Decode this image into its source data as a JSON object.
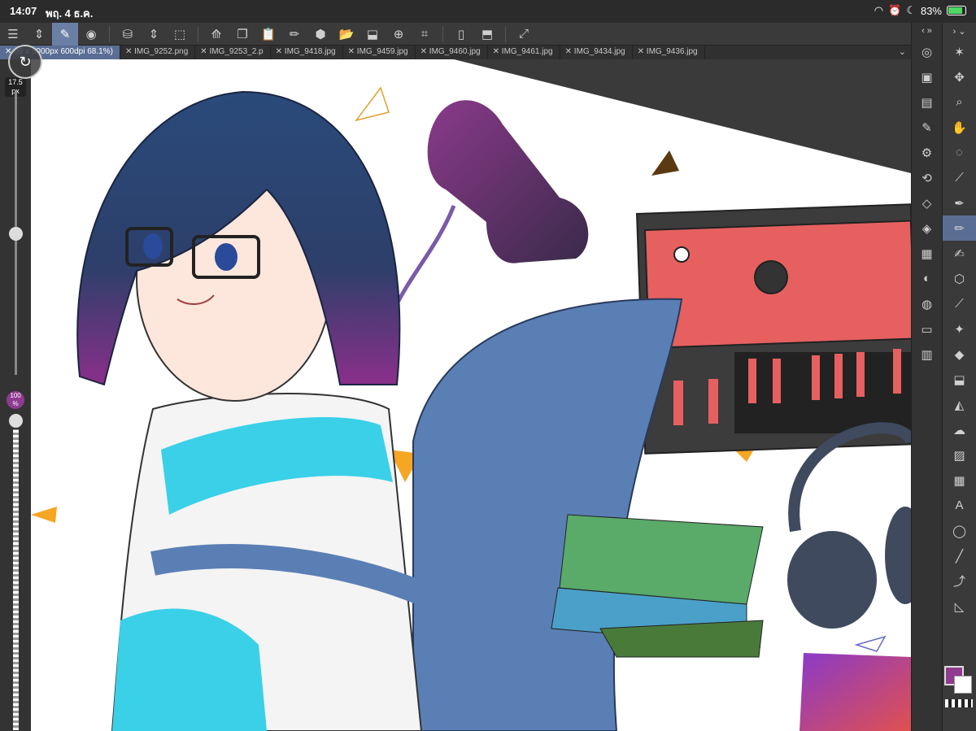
{
  "status": {
    "time": "14:07",
    "date": "พฤ. 4 ธ.ค.",
    "battery": "83%"
  },
  "toolbar": {
    "icons": [
      "menu-icon",
      "updown-icon",
      "edit-tool-icon",
      "layer-icon",
      "bucket-icon",
      "updown2-icon",
      "select-icon",
      "transform-icon",
      "copy-icon",
      "paste-icon",
      "pen-icon",
      "fill-icon",
      "folder-icon",
      "export-icon",
      "new-layer-icon",
      "crop-icon",
      "device-icon",
      "crop2-icon",
      "expand-icon"
    ]
  },
  "tabs": [
    {
      "label": "89 x 5000px 600dpi 68.1%)",
      "active": true
    },
    {
      "label": "IMG_9252.png"
    },
    {
      "label": "IMG_9253_2.p"
    },
    {
      "label": "IMG_9418.jpg"
    },
    {
      "label": "IMG_9459.jpg"
    },
    {
      "label": "IMG_9460.jpg"
    },
    {
      "label": "IMG_9461.jpg"
    },
    {
      "label": "IMG_9434.jpg"
    },
    {
      "label": "IMG_9436.jpg"
    }
  ],
  "left_panel": {
    "brush_size": "17.5 px",
    "opacity": "100 %"
  },
  "colors": {
    "foreground": "#8f3b8f",
    "background": "#ffffff",
    "accent": "#5a6e94"
  }
}
